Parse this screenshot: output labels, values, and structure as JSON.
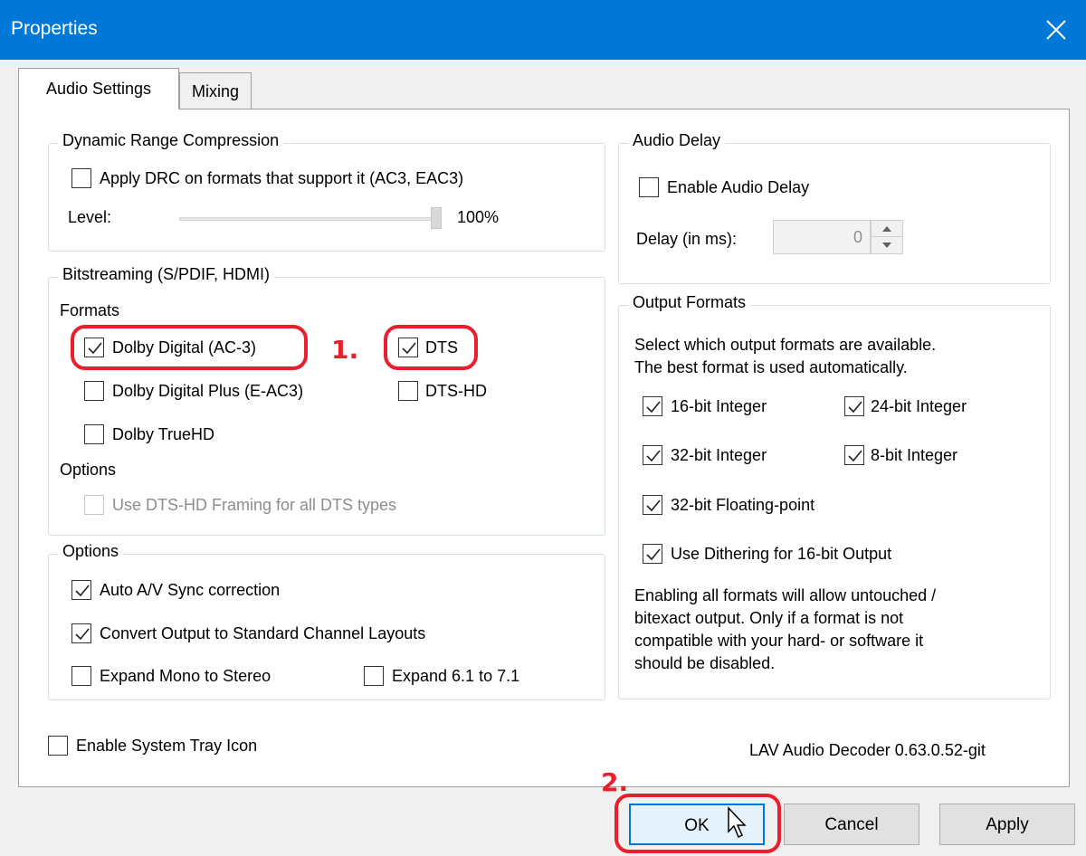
{
  "window": {
    "title": "Properties",
    "close_icon": "close-icon"
  },
  "tabs": [
    {
      "label": "Audio Settings",
      "active": true
    },
    {
      "label": "Mixing",
      "active": false
    }
  ],
  "drc": {
    "legend": "Dynamic Range Compression",
    "apply_label": "Apply DRC on formats that support it (AC3, EAC3)",
    "apply_checked": false,
    "level_label": "Level:",
    "level_value": "100%",
    "level_fraction": 1.0
  },
  "bitstreaming": {
    "legend": "Bitstreaming (S/PDIF, HDMI)",
    "formats_label": "Formats",
    "formats": [
      {
        "label": "Dolby Digital (AC-3)",
        "checked": true
      },
      {
        "label": "DTS",
        "checked": true
      },
      {
        "label": "Dolby Digital Plus (E-AC3)",
        "checked": false
      },
      {
        "label": "DTS-HD",
        "checked": false
      },
      {
        "label": "Dolby TrueHD",
        "checked": false
      }
    ],
    "options_label": "Options",
    "dtshd_framing_label": "Use DTS-HD Framing for all DTS types",
    "dtshd_framing_checked": false
  },
  "options": {
    "legend": "Options",
    "items": [
      {
        "label": "Auto A/V Sync correction",
        "checked": true
      },
      {
        "label": "Convert Output to Standard Channel Layouts",
        "checked": true
      },
      {
        "label": "Expand Mono to Stereo",
        "checked": false
      },
      {
        "label": "Expand 6.1 to 7.1",
        "checked": false
      }
    ]
  },
  "audio_delay": {
    "legend": "Audio Delay",
    "enable_label": "Enable Audio Delay",
    "enable_checked": false,
    "delay_label": "Delay (in ms):",
    "delay_value": "0"
  },
  "output_formats": {
    "legend": "Output Formats",
    "description_line1": "Select which output formats are available.",
    "description_line2": "The best format is used automatically.",
    "formats": [
      {
        "label": "16-bit Integer",
        "checked": true
      },
      {
        "label": "24-bit Integer",
        "checked": true
      },
      {
        "label": "32-bit Integer",
        "checked": true
      },
      {
        "label": "8-bit Integer",
        "checked": true
      },
      {
        "label": "32-bit Floating-point",
        "checked": true
      }
    ],
    "dithering_label": "Use Dithering for 16-bit Output",
    "dithering_checked": true,
    "note_lines": [
      "Enabling all formats will allow untouched /",
      "bitexact output. Only if a format is not",
      "compatible with your hard- or software it",
      "should be disabled."
    ]
  },
  "footer": {
    "tray_label": "Enable System Tray Icon",
    "tray_checked": false,
    "version": "LAV Audio Decoder 0.63.0.52-git"
  },
  "buttons": {
    "ok": "OK",
    "cancel": "Cancel",
    "apply": "Apply"
  },
  "annotations": {
    "step1": "1.",
    "step2": "2.",
    "highlight_color": "#e8202e"
  },
  "colors": {
    "titlebar": "#0078d7",
    "ok_border": "#0078d7"
  }
}
